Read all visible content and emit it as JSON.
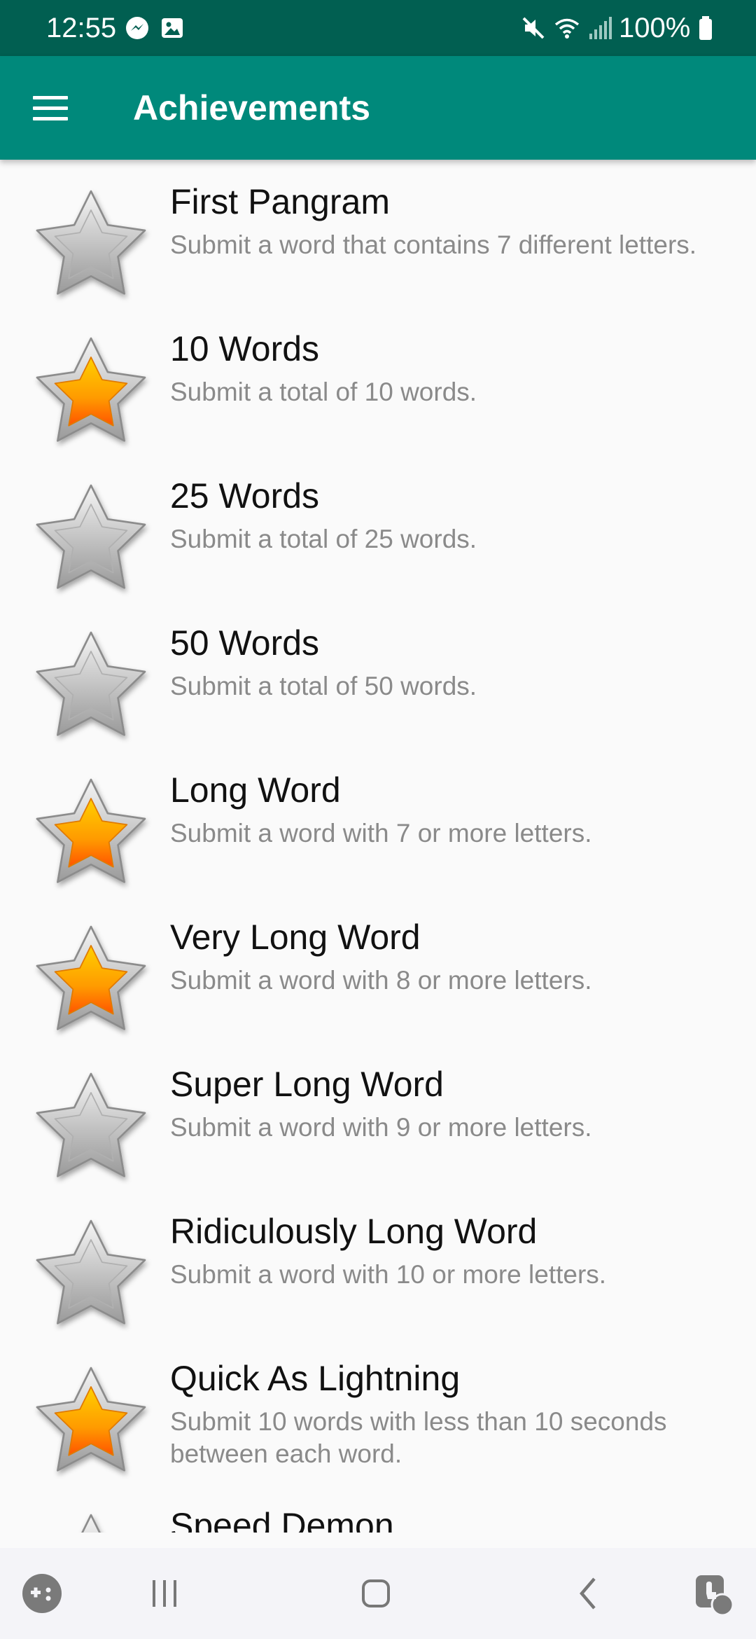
{
  "status_bar": {
    "time": "12:55",
    "battery": "100%",
    "icons": [
      "messenger-icon",
      "gallery-icon",
      "mute-icon",
      "wifi-icon",
      "signal-icon",
      "battery-icon"
    ]
  },
  "app_bar": {
    "title": "Achievements",
    "menu_icon": "hamburger-menu-icon",
    "color": "#00897b"
  },
  "achievements": [
    {
      "name": "First Pangram",
      "description": "Submit a word that contains 7 different letters.",
      "unlocked": false
    },
    {
      "name": "10 Words",
      "description": "Submit a total of 10 words.",
      "unlocked": true
    },
    {
      "name": "25 Words",
      "description": "Submit a total of 25 words.",
      "unlocked": false
    },
    {
      "name": "50 Words",
      "description": "Submit a total of 50 words.",
      "unlocked": false
    },
    {
      "name": "Long Word",
      "description": "Submit a word with 7 or more letters.",
      "unlocked": true
    },
    {
      "name": "Very Long Word",
      "description": "Submit a word with 8 or more letters.",
      "unlocked": true
    },
    {
      "name": "Super Long Word",
      "description": "Submit a word with 9 or more letters.",
      "unlocked": false
    },
    {
      "name": "Ridiculously Long Word",
      "description": "Submit a word with 10 or more letters.",
      "unlocked": false
    },
    {
      "name": "Quick As Lightning",
      "description": "Submit 10 words with less than 10 seconds between each word.",
      "unlocked": true
    },
    {
      "name": "Speed Demon",
      "description": "",
      "unlocked": false
    }
  ],
  "nav_bar": {
    "icons": [
      "game-launcher-icon",
      "recents-icon",
      "home-icon",
      "back-icon",
      "assistive-touch-icon"
    ]
  },
  "colors": {
    "status_bar": "#015f51",
    "accent": "#00897b",
    "star_unlocked": "#ffa000",
    "star_locked": "#c4c4c4"
  }
}
